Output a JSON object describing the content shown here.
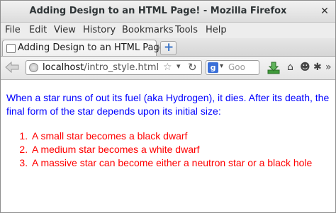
{
  "window": {
    "title": "Adding Design to an HTML Page! - Mozilla Firefox",
    "close_glyph": "✕"
  },
  "menu": [
    "File",
    "Edit",
    "View",
    "History",
    "Bookmarks",
    "Tools",
    "Help"
  ],
  "tab": {
    "label": "Adding Design to an HTML Page!",
    "new_tab": "+"
  },
  "navbar": {
    "url_host": "localhost",
    "url_path": "/intro_style.html",
    "search_placeholder": "Goo",
    "search_engine_letter": "g"
  },
  "page": {
    "paragraph": "When a star runs of out its fuel (aka Hydrogen), it dies. After its death, the final form of the star depends upon its initial size:",
    "list_items": [
      "A small star becomes a black dwarf",
      "A medium star becomes a white dwarf",
      "A massive star can become either a neutron star or a black hole"
    ],
    "paragraph_color": "#0000ff",
    "list_color": "#ff0000"
  }
}
